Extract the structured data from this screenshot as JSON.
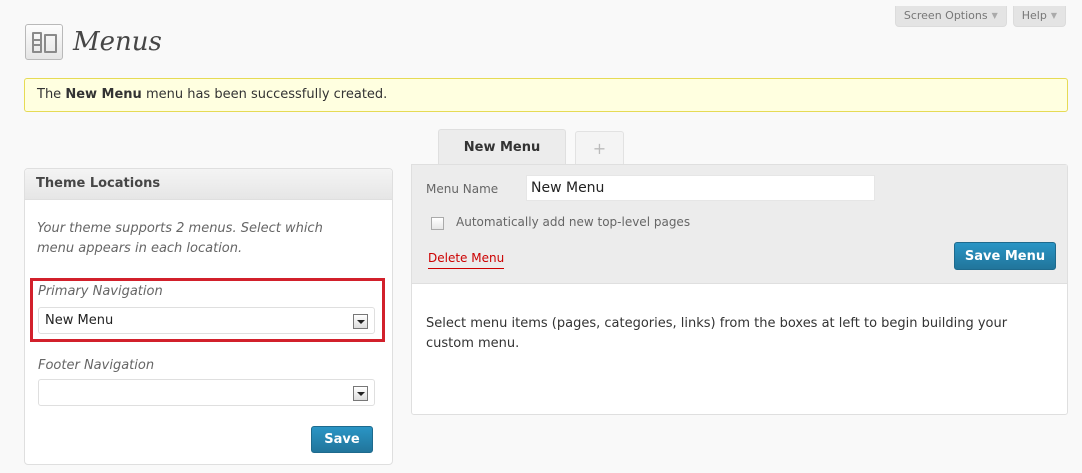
{
  "screen_meta": {
    "screen_options_label": "Screen Options",
    "help_label": "Help",
    "arrow_icon": "▼"
  },
  "header": {
    "title": "Menus",
    "icon": "menus-icon"
  },
  "notice": {
    "prefix": "The ",
    "menu_name": "New Menu",
    "suffix": " menu has been successfully created."
  },
  "theme_locations": {
    "title": "Theme Locations",
    "description": "Your theme supports 2 menus. Select which menu appears in each location.",
    "locations": [
      {
        "label": "Primary Navigation",
        "selected": "New Menu"
      },
      {
        "label": "Footer Navigation",
        "selected": ""
      }
    ],
    "save_label": "Save"
  },
  "tabs": {
    "active_label": "New Menu",
    "add_label": "+"
  },
  "menu_editor": {
    "name_label": "Menu Name",
    "name_value": "New Menu",
    "auto_add_label": "Automatically add new top-level pages",
    "auto_add_checked": false,
    "delete_label": "Delete Menu",
    "save_label": "Save Menu",
    "body_text": "Select menu items (pages, categories, links) from the boxes at left to begin building your custom menu."
  },
  "colors": {
    "notice_bg": "#ffffe0",
    "primary_button": "#21759b",
    "highlight": "#d2202b",
    "delete_link": "#cc0000"
  }
}
